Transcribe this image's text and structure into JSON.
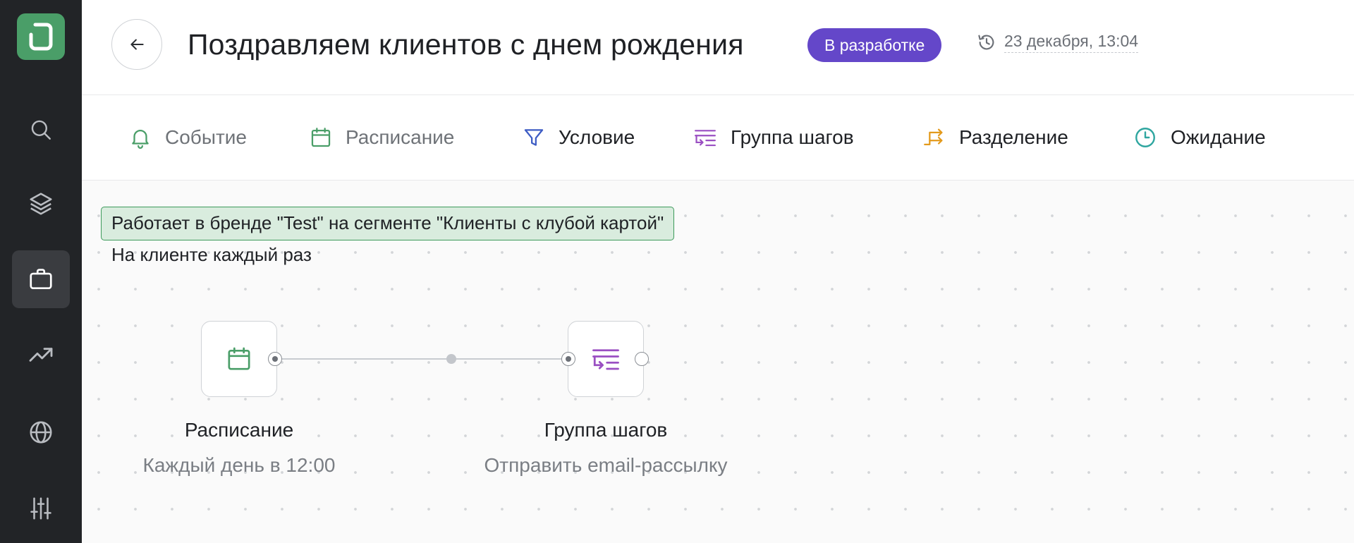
{
  "header": {
    "title": "Поздравляем клиентов с днем рождения",
    "status": "В разработке",
    "updated": "23 декабря, 13:04",
    "icons": {
      "back": "arrow-left-icon",
      "history": "history-icon"
    }
  },
  "sidebar": {
    "items": [
      {
        "icon": "search-icon"
      },
      {
        "icon": "layers-icon"
      },
      {
        "icon": "briefcase-icon",
        "active": true
      },
      {
        "icon": "trending-up-icon"
      },
      {
        "icon": "globe-icon"
      },
      {
        "icon": "sliders-icon"
      }
    ],
    "logo_color": "#4a9e68",
    "active_color": "#3a3c40"
  },
  "toolbar": {
    "items": [
      {
        "label": "Событие",
        "icon": "bell-icon",
        "color": "#4a9e68",
        "muted": true
      },
      {
        "label": "Расписание",
        "icon": "calendar-icon",
        "color": "#4a9e68",
        "muted": true
      },
      {
        "label": "Условие",
        "icon": "filter-icon",
        "color": "#3d5cc4"
      },
      {
        "label": "Группа шагов",
        "icon": "step-group-icon",
        "color": "#9a4fc2"
      },
      {
        "label": "Разделение",
        "icon": "split-icon",
        "color": "#e39a1c"
      },
      {
        "label": "Ожидание",
        "icon": "clock-icon",
        "color": "#2fa6a0"
      }
    ]
  },
  "canvas": {
    "scope_banner": "Работает в бренде \"Test\" на сегменте \"Клиенты с клубой картой\"",
    "scope_sub": "На клиенте каждый раз",
    "nodes": [
      {
        "title": "Расписание",
        "description": "Каждый день в 12:00",
        "icon": "calendar-icon",
        "color": "#4a9e68"
      },
      {
        "title": "Группа шагов",
        "description": "Отправить email-рассылку",
        "icon": "step-group-icon",
        "color": "#9a4fc2"
      }
    ]
  },
  "colors": {
    "badge": "#6447c9",
    "banner_bg": "#d9ecde",
    "banner_border": "#3d9a5b"
  }
}
